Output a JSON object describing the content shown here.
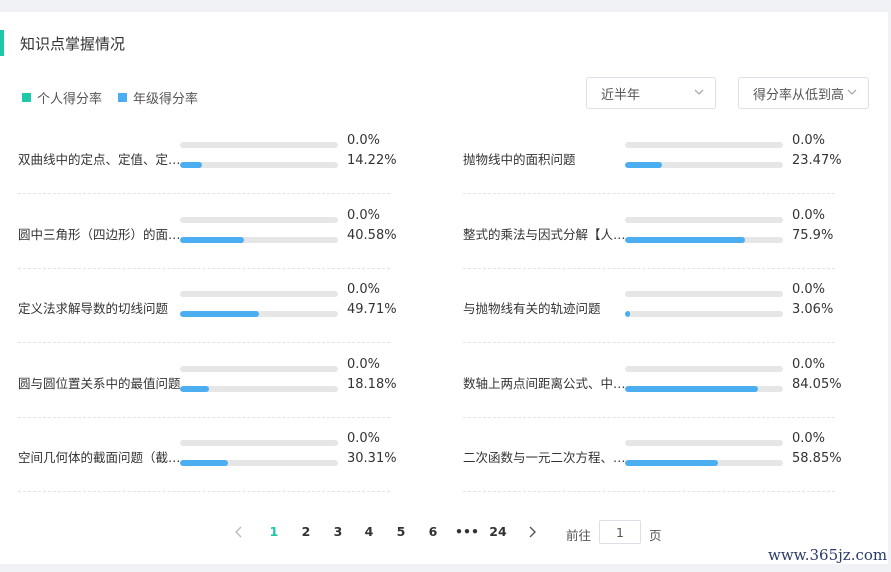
{
  "header": {
    "title": "知识点掌握情况"
  },
  "legend": [
    {
      "label": "个人得分率",
      "color": "#1ec8a8"
    },
    {
      "label": "年级得分率",
      "color": "#4aaef0"
    }
  ],
  "filters": {
    "period": "近半年",
    "sort": "得分率从低到高"
  },
  "items": [
    {
      "label": "双曲线中的定点、定值、定值问题",
      "personal": "0.0%",
      "grade": "14.22%",
      "personal_value": 0.0,
      "grade_value": 14.22
    },
    {
      "label": "抛物线中的面积问题",
      "personal": "0.0%",
      "grade": "23.47%",
      "personal_value": 0.0,
      "grade_value": 23.47
    },
    {
      "label": "圆中三角形（四边形）的面积问题",
      "personal": "0.0%",
      "grade": "40.58%",
      "personal_value": 0.0,
      "grade_value": 40.58
    },
    {
      "label": "整式的乘法与因式分解【人教版】",
      "personal": "0.0%",
      "grade": "75.9%",
      "personal_value": 0.0,
      "grade_value": 75.9
    },
    {
      "label": "定义法求解导数的切线问题",
      "personal": "0.0%",
      "grade": "49.71%",
      "personal_value": 0.0,
      "grade_value": 49.71
    },
    {
      "label": "与抛物线有关的轨迹问题",
      "personal": "0.0%",
      "grade": "3.06%",
      "personal_value": 0.0,
      "grade_value": 3.06
    },
    {
      "label": "圆与圆位置关系中的最值问题",
      "personal": "0.0%",
      "grade": "18.18%",
      "personal_value": 0.0,
      "grade_value": 18.18
    },
    {
      "label": "数轴上两点间距离公式、中点公式",
      "personal": "0.0%",
      "grade": "84.05%",
      "personal_value": 0.0,
      "grade_value": 84.05
    },
    {
      "label": "空间几何体的截面问题（截面形状）",
      "personal": "0.0%",
      "grade": "30.31%",
      "personal_value": 0.0,
      "grade_value": 30.31
    },
    {
      "label": "二次函数与一元二次方程、不等式",
      "personal": "0.0%",
      "grade": "58.85%",
      "personal_value": 0.0,
      "grade_value": 58.85
    }
  ],
  "pagination": {
    "pages": [
      "1",
      "2",
      "3",
      "4",
      "5",
      "6",
      "•••",
      "24"
    ],
    "active": "1",
    "goto_prefix": "前往",
    "goto_value": "1",
    "goto_suffix": "页"
  },
  "watermark": "www.365jz.com"
}
